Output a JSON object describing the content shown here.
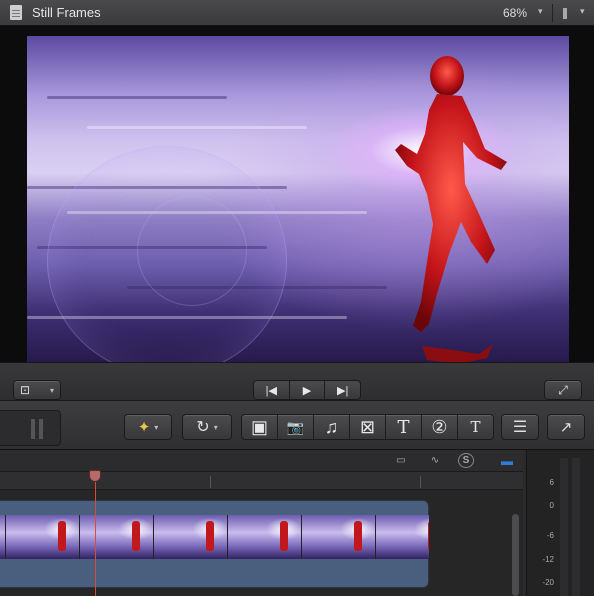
{
  "viewer": {
    "title": "Still Frames",
    "zoom": "68%",
    "zoom_caret": "▾",
    "view_caret": "▾"
  },
  "viewer_controls": {
    "transform_icon": "crop-transform-icon",
    "caret": "▾",
    "prev_glyph": "|◀",
    "play_glyph": "▶",
    "next_glyph": "▶|",
    "fullscreen_glyph": "⤢"
  },
  "toolbar": {
    "effects_glyph": "✦",
    "retime_glyph": "↻",
    "browsers": [
      {
        "icon": "event-browser-icon",
        "glyph": "▣"
      },
      {
        "icon": "camera-icon",
        "glyph": "📷"
      },
      {
        "icon": "music-icon",
        "glyph": "♫"
      },
      {
        "icon": "transitions-icon",
        "glyph": "⊠"
      },
      {
        "icon": "titles-icon",
        "glyph": "T"
      },
      {
        "icon": "generators-icon",
        "glyph": "②"
      },
      {
        "icon": "themes-icon",
        "glyph": "T"
      }
    ],
    "inspector_glyph": "☰",
    "share_glyph": "↗"
  },
  "timeline": {
    "toggles": [
      {
        "icon": "clip-appearance-icon",
        "glyph": "▭"
      },
      {
        "icon": "audio-waveform-icon",
        "glyph": "∿"
      },
      {
        "icon": "solo-icon",
        "glyph": "S"
      },
      {
        "icon": "snapping-icon",
        "glyph": "▬"
      }
    ]
  },
  "audio_meter": {
    "labels": [
      "6",
      "0",
      "-6",
      "-12",
      "-20"
    ]
  },
  "colors": {
    "accent_blue": "#2f7bd9",
    "playhead": "#d94a3a",
    "storyline": "#4a5f7e"
  }
}
